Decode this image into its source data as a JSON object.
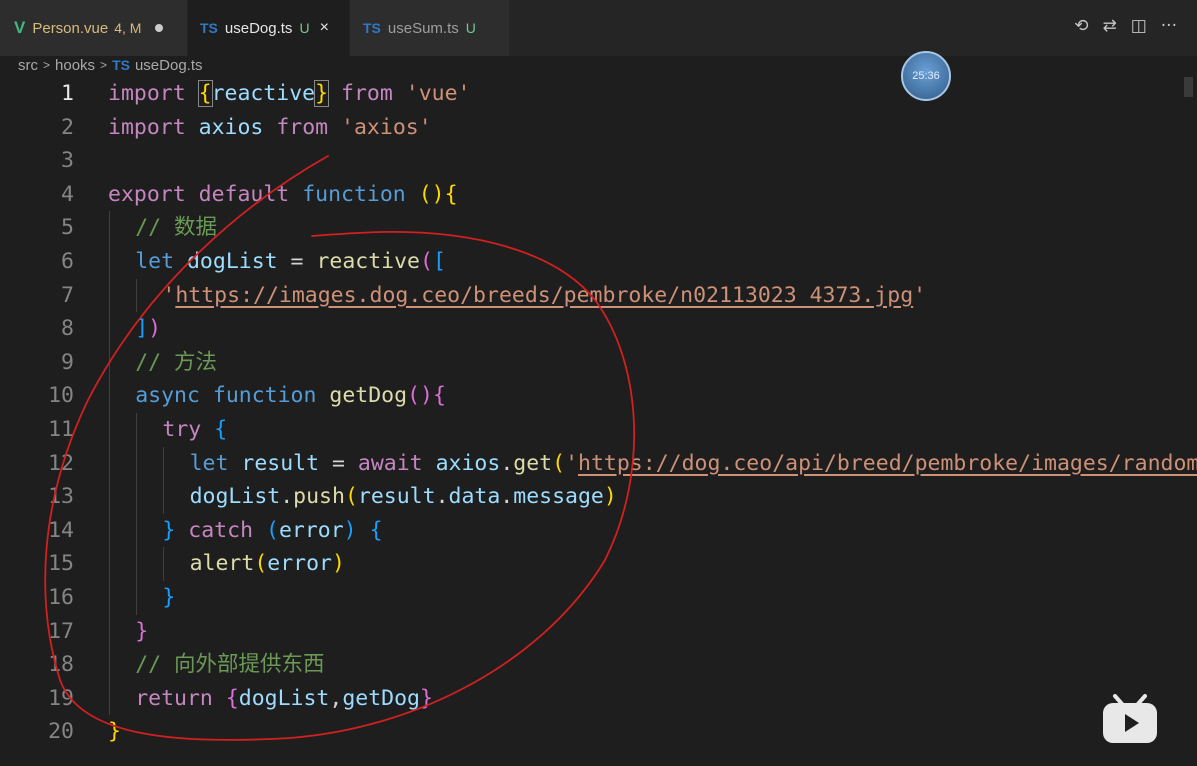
{
  "tabs": [
    {
      "icon": "V",
      "name": "Person.vue",
      "badge": "4, M",
      "modified_dot": true
    },
    {
      "icon": "TS",
      "name": "useDog.ts",
      "badge": "U",
      "active": true,
      "close": "×"
    },
    {
      "icon": "TS",
      "name": "useSum.ts",
      "badge": "U"
    }
  ],
  "actions": {
    "history_icon": "⟲",
    "compare_icon": "⇄",
    "split_icon": "◫",
    "more_icon": "···"
  },
  "breadcrumb": {
    "folder1": "src",
    "folder2": "hooks",
    "file_icon": "TS",
    "file": "useDog.ts",
    "sep": ">"
  },
  "clock": {
    "time": "25:36"
  },
  "current_line": 1,
  "lines": [
    {
      "n": "1",
      "tokens": [
        [
          "kw",
          "import"
        ],
        [
          "t",
          " "
        ],
        [
          "b1",
          "{"
        ],
        [
          "var",
          "reactive"
        ],
        [
          "b1",
          "}"
        ],
        [
          "t",
          " "
        ],
        [
          "kw",
          "from"
        ],
        [
          "t",
          " "
        ],
        [
          "str",
          "'vue'"
        ]
      ]
    },
    {
      "n": "2",
      "tokens": [
        [
          "kw",
          "import"
        ],
        [
          "t",
          " "
        ],
        [
          "var",
          "axios"
        ],
        [
          "t",
          " "
        ],
        [
          "kw",
          "from"
        ],
        [
          "t",
          " "
        ],
        [
          "str",
          "'axios'"
        ]
      ]
    },
    {
      "n": "3",
      "tokens": []
    },
    {
      "n": "4",
      "tokens": [
        [
          "kw",
          "export"
        ],
        [
          "t",
          " "
        ],
        [
          "kw",
          "default"
        ],
        [
          "t",
          " "
        ],
        [
          "st",
          "function"
        ],
        [
          "t",
          " "
        ],
        [
          "b1",
          "()"
        ],
        [
          "b1",
          "{"
        ]
      ]
    },
    {
      "n": "5",
      "indent": 1,
      "tokens": [
        [
          "cm",
          "// 数据"
        ]
      ]
    },
    {
      "n": "6",
      "indent": 1,
      "tokens": [
        [
          "st",
          "let"
        ],
        [
          "t",
          " "
        ],
        [
          "var",
          "dogList"
        ],
        [
          "t",
          " = "
        ],
        [
          "fn",
          "reactive"
        ],
        [
          "b2",
          "("
        ],
        [
          "b3",
          "["
        ]
      ]
    },
    {
      "n": "7",
      "indent": 2,
      "tokens": [
        [
          "str",
          "'"
        ],
        [
          "strlink",
          "https://images.dog.ceo/breeds/pembroke/n02113023_4373.jpg"
        ],
        [
          "str",
          "'"
        ]
      ]
    },
    {
      "n": "8",
      "indent": 1,
      "tokens": [
        [
          "b3",
          "]"
        ],
        [
          "b2",
          ")"
        ]
      ]
    },
    {
      "n": "9",
      "indent": 1,
      "tokens": [
        [
          "cm",
          "// 方法"
        ]
      ]
    },
    {
      "n": "10",
      "indent": 1,
      "tokens": [
        [
          "st",
          "async"
        ],
        [
          "t",
          " "
        ],
        [
          "st",
          "function"
        ],
        [
          "t",
          " "
        ],
        [
          "fn",
          "getDog"
        ],
        [
          "b2",
          "()"
        ],
        [
          "b2",
          "{"
        ]
      ]
    },
    {
      "n": "11",
      "indent": 2,
      "tokens": [
        [
          "kw",
          "try"
        ],
        [
          "t",
          " "
        ],
        [
          "b3",
          "{"
        ]
      ]
    },
    {
      "n": "12",
      "indent": 3,
      "tokens": [
        [
          "st",
          "let"
        ],
        [
          "t",
          " "
        ],
        [
          "var",
          "result"
        ],
        [
          "t",
          " = "
        ],
        [
          "kw",
          "await"
        ],
        [
          "t",
          " "
        ],
        [
          "var",
          "axios"
        ],
        [
          "t",
          "."
        ],
        [
          "fn",
          "get"
        ],
        [
          "b1",
          "("
        ],
        [
          "str",
          "'"
        ],
        [
          "strlink",
          "https://dog.ceo/api/breed/pembroke/images/random"
        ]
      ]
    },
    {
      "n": "13",
      "indent": 3,
      "tokens": [
        [
          "var",
          "dogList"
        ],
        [
          "t",
          "."
        ],
        [
          "fn",
          "push"
        ],
        [
          "b1",
          "("
        ],
        [
          "var",
          "result"
        ],
        [
          "t",
          "."
        ],
        [
          "var",
          "data"
        ],
        [
          "t",
          "."
        ],
        [
          "var",
          "message"
        ],
        [
          "b1",
          ")"
        ]
      ]
    },
    {
      "n": "14",
      "indent": 2,
      "tokens": [
        [
          "b3",
          "}"
        ],
        [
          "t",
          " "
        ],
        [
          "kw",
          "catch"
        ],
        [
          "t",
          " "
        ],
        [
          "b3",
          "("
        ],
        [
          "var",
          "error"
        ],
        [
          "b3",
          ")"
        ],
        [
          "t",
          " "
        ],
        [
          "b3",
          "{"
        ]
      ]
    },
    {
      "n": "15",
      "indent": 3,
      "tokens": [
        [
          "fn",
          "alert"
        ],
        [
          "b1",
          "("
        ],
        [
          "var",
          "error"
        ],
        [
          "b1",
          ")"
        ]
      ]
    },
    {
      "n": "16",
      "indent": 2,
      "tokens": [
        [
          "b3",
          "}"
        ]
      ]
    },
    {
      "n": "17",
      "indent": 1,
      "tokens": [
        [
          "b2",
          "}"
        ]
      ]
    },
    {
      "n": "18",
      "indent": 1,
      "tokens": [
        [
          "cm",
          "// 向外部提供东西"
        ]
      ]
    },
    {
      "n": "19",
      "indent": 1,
      "tokens": [
        [
          "kw",
          "return"
        ],
        [
          "t",
          " "
        ],
        [
          "b2",
          "{"
        ],
        [
          "var",
          "dogList"
        ],
        [
          "t",
          ","
        ],
        [
          "var",
          "getDog"
        ],
        [
          "b2",
          "}"
        ]
      ]
    },
    {
      "n": "20",
      "tokens": [
        [
          "b1",
          "}"
        ]
      ]
    }
  ],
  "colors": {
    "annotation_ink": "#d22020",
    "bilibili_logo": "#e8e8e8"
  },
  "watermark_icon": "bilibili-tv-icon"
}
